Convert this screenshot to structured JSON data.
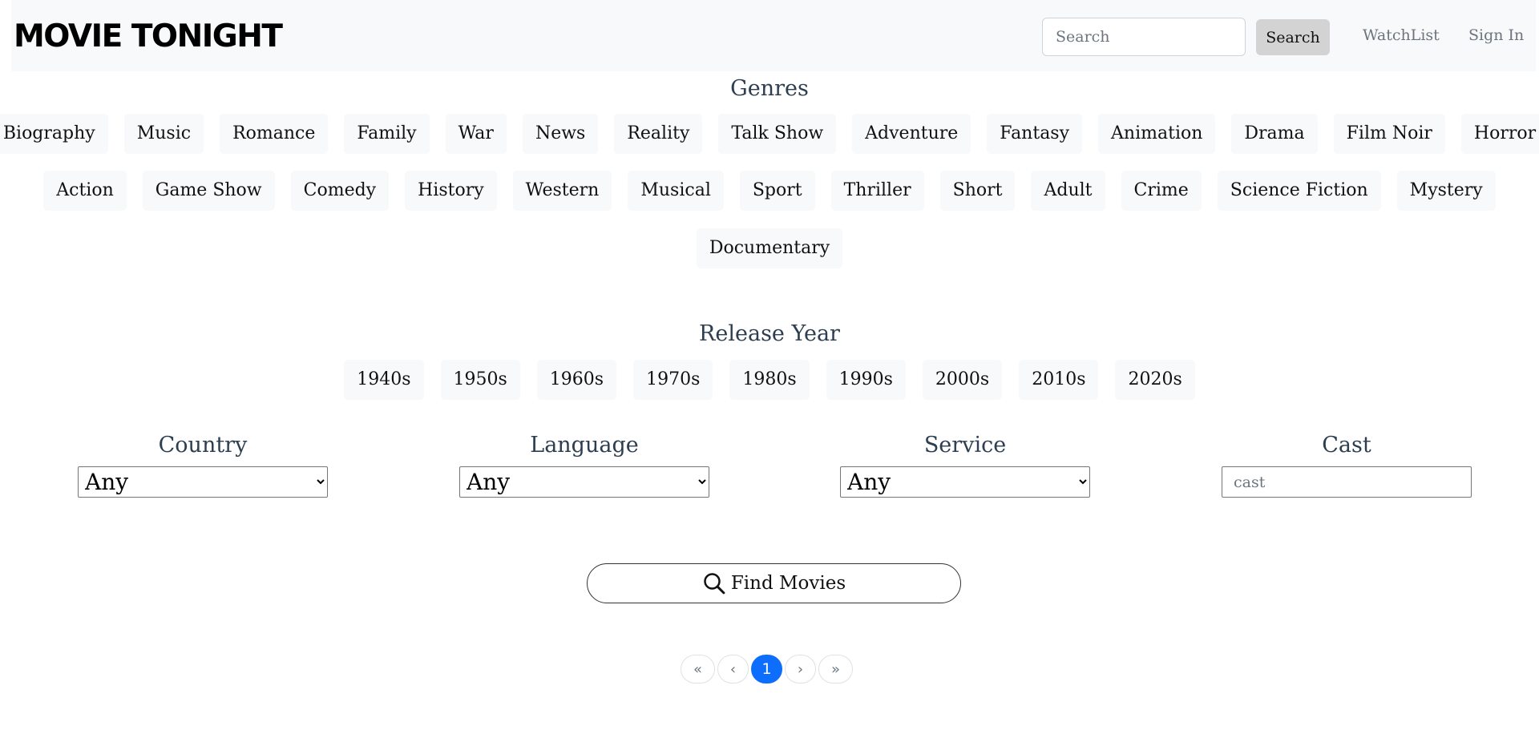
{
  "header": {
    "brand": "MOVIE TONIGHT",
    "search_placeholder": "Search",
    "search_button": "Search",
    "watchlist_link": "WatchList",
    "signin_link": "Sign In"
  },
  "genres": {
    "title": "Genres",
    "rows": [
      [
        "Biography",
        "Music",
        "Romance",
        "Family",
        "War",
        "News",
        "Reality",
        "Talk Show",
        "Adventure",
        "Fantasy",
        "Animation",
        "Drama",
        "Film Noir",
        "Horror"
      ],
      [
        "Action",
        "Game Show",
        "Comedy",
        "History",
        "Western",
        "Musical",
        "Sport",
        "Thriller",
        "Short",
        "Adult",
        "Crime",
        "Science Fiction",
        "Mystery"
      ],
      [
        "Documentary"
      ]
    ]
  },
  "release_year": {
    "title": "Release Year",
    "decades": [
      "1940s",
      "1950s",
      "1960s",
      "1970s",
      "1980s",
      "1990s",
      "2000s",
      "2010s",
      "2020s"
    ]
  },
  "filters": {
    "country": {
      "label": "Country",
      "selected": "Any"
    },
    "language": {
      "label": "Language",
      "selected": "Any"
    },
    "service": {
      "label": "Service",
      "selected": "Any"
    },
    "cast": {
      "label": "Cast",
      "placeholder": "cast"
    }
  },
  "find_button": {
    "label": "Find Movies",
    "icon": "search-icon"
  },
  "pagination": {
    "first": "«",
    "prev": "‹",
    "current": "1",
    "next": "›",
    "last": "»",
    "active_color": "#0d6efd"
  }
}
